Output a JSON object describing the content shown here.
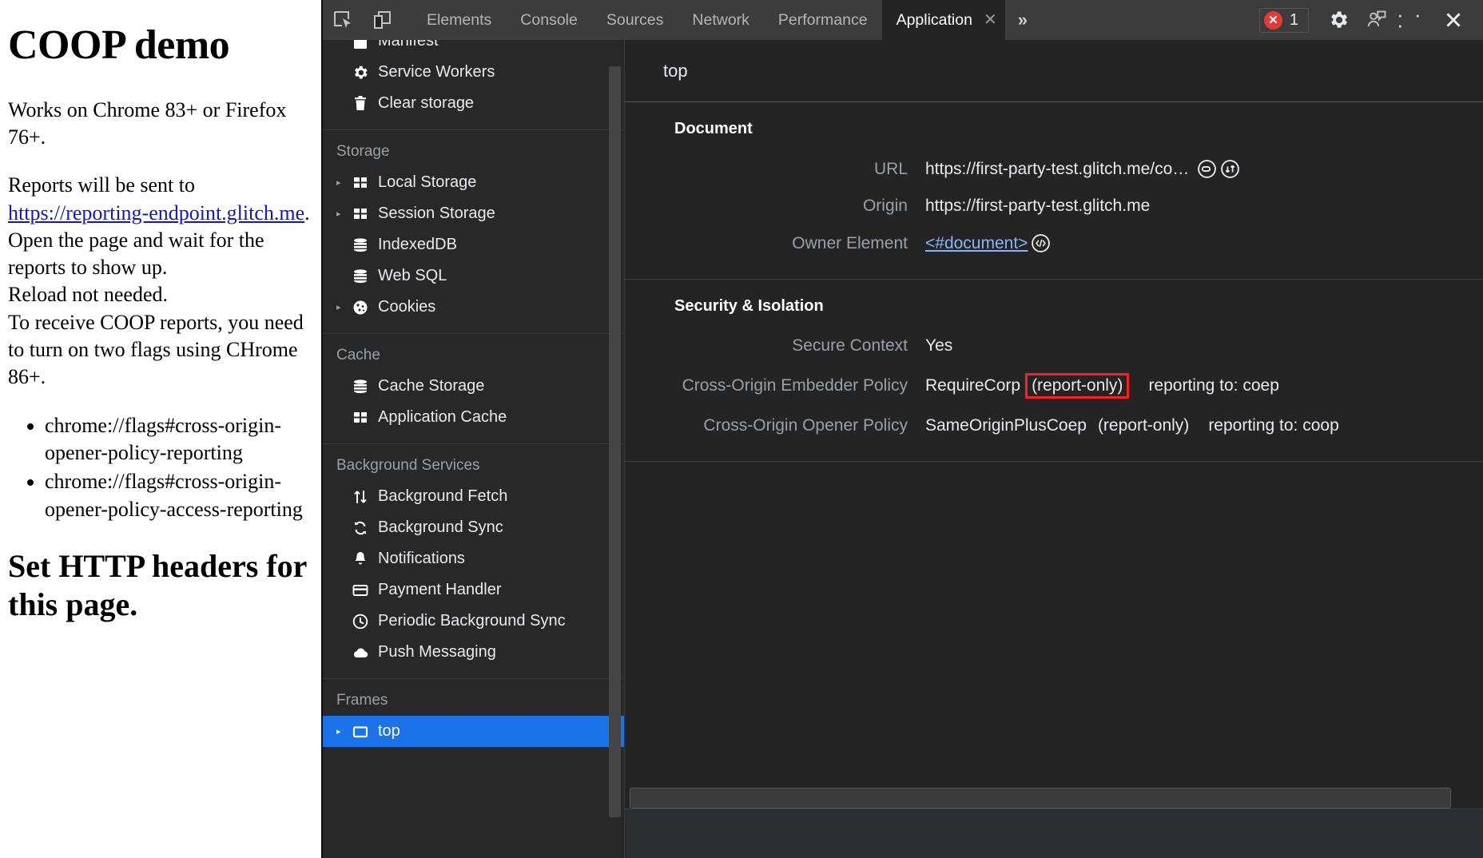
{
  "webpage": {
    "title": "COOP demo",
    "paragraphs": [
      "Works on Chrome 83+ or Firefox 76+.",
      "Reports will be sent to ",
      "Open the page and wait for the reports to show up.",
      "Reload not needed.",
      "To receive COOP reports, you need to turn on two flags using CHrome 86+."
    ],
    "link_text": "https://reporting-endpoint.glitch.me",
    "link_suffix": ".",
    "flags": [
      "chrome://flags#cross-origin-opener-policy-reporting",
      "chrome://flags#cross-origin-opener-policy-access-reporting"
    ],
    "subheading": "Set HTTP headers for this page."
  },
  "devtools": {
    "toolbar": {
      "inspect_icon": "inspect-element-icon",
      "device_icon": "device-toolbar-icon",
      "tabs": [
        {
          "label": "Elements",
          "active": false
        },
        {
          "label": "Console",
          "active": false
        },
        {
          "label": "Sources",
          "active": false
        },
        {
          "label": "Network",
          "active": false
        },
        {
          "label": "Performance",
          "active": false
        },
        {
          "label": "Application",
          "active": true
        }
      ],
      "more_tabs_label": "»",
      "tab_close_label": "✕",
      "error_count": "1",
      "settings_icon": "gear-icon",
      "feedback_icon": "feedback-person-icon",
      "more_options_label": "· · ·",
      "close_label": "✕"
    },
    "sidebar": {
      "groups": [
        {
          "header": "",
          "items": [
            {
              "label": "Manifest",
              "icon": "manifest-icon",
              "arrow": false,
              "selected": false,
              "clipped": true
            },
            {
              "label": "Service Workers",
              "icon": "gear-icon",
              "arrow": false,
              "selected": false
            },
            {
              "label": "Clear storage",
              "icon": "trash-icon",
              "arrow": false,
              "selected": false
            }
          ]
        },
        {
          "header": "Storage",
          "items": [
            {
              "label": "Local Storage",
              "icon": "table-icon",
              "arrow": true,
              "selected": false
            },
            {
              "label": "Session Storage",
              "icon": "table-icon",
              "arrow": true,
              "selected": false
            },
            {
              "label": "IndexedDB",
              "icon": "database-icon",
              "arrow": false,
              "selected": false
            },
            {
              "label": "Web SQL",
              "icon": "database-icon",
              "arrow": false,
              "selected": false
            },
            {
              "label": "Cookies",
              "icon": "cookie-icon",
              "arrow": true,
              "selected": false
            }
          ]
        },
        {
          "header": "Cache",
          "items": [
            {
              "label": "Cache Storage",
              "icon": "database-icon",
              "arrow": false,
              "selected": false
            },
            {
              "label": "Application Cache",
              "icon": "table-icon",
              "arrow": false,
              "selected": false
            }
          ]
        },
        {
          "header": "Background Services",
          "items": [
            {
              "label": "Background Fetch",
              "icon": "updown-arrows-icon",
              "arrow": false,
              "selected": false
            },
            {
              "label": "Background Sync",
              "icon": "sync-icon",
              "arrow": false,
              "selected": false
            },
            {
              "label": "Notifications",
              "icon": "bell-icon",
              "arrow": false,
              "selected": false
            },
            {
              "label": "Payment Handler",
              "icon": "credit-card-icon",
              "arrow": false,
              "selected": false
            },
            {
              "label": "Periodic Background Sync",
              "icon": "clock-icon",
              "arrow": false,
              "selected": false
            },
            {
              "label": "Push Messaging",
              "icon": "cloud-icon",
              "arrow": false,
              "selected": false
            }
          ]
        },
        {
          "header": "Frames",
          "items": [
            {
              "label": "top",
              "icon": "frame-icon",
              "arrow": true,
              "selected": true
            }
          ]
        }
      ]
    },
    "main": {
      "frame_title": "top",
      "sections": [
        {
          "title": "Document",
          "rows": [
            {
              "label": "URL",
              "value": "https://first-party-test.glitch.me/co…",
              "icons": [
                "reveal-in-network-icon",
                "open-in-sources-icon"
              ]
            },
            {
              "label": "Origin",
              "value": "https://first-party-test.glitch.me",
              "icons": []
            },
            {
              "label": "Owner Element",
              "value": "<#document>",
              "link": true,
              "icons": [
                "code-icon"
              ]
            }
          ]
        },
        {
          "title": "Security & Isolation",
          "rows": [
            {
              "label": "Secure Context",
              "value": "Yes",
              "icons": []
            },
            {
              "label": "Cross-Origin Embedder Policy",
              "value": "RequireCorp",
              "report_only": "(report-only)",
              "highlight": true,
              "reporting": "reporting to: coep"
            },
            {
              "label": "Cross-Origin Opener Policy",
              "value": "SameOriginPlusCoep",
              "report_only": "(report-only)",
              "highlight": false,
              "reporting": "reporting to: coop"
            }
          ]
        }
      ]
    },
    "colors": {
      "accent": "#1a73e8",
      "link": "#8ab4f8",
      "error": "#e53935",
      "highlight": "#ff1f1f",
      "panel_bg": "#242424",
      "sidebar_bg": "#282828",
      "toolbar_bg": "#3c3c3c"
    }
  }
}
